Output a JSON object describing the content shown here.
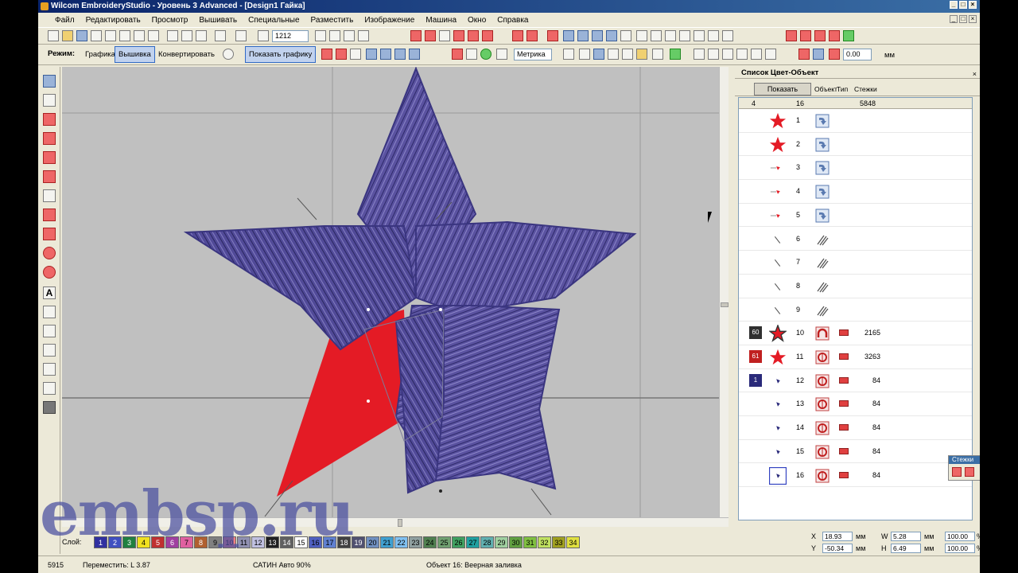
{
  "window": {
    "title": "Wilcom EmbroideryStudio - Уровень 3 Advanced - [Design1         Гайка]",
    "controls": [
      "_",
      "□",
      "×"
    ]
  },
  "menu": [
    "Файл",
    "Редактировать",
    "Просмотр",
    "Вышивать",
    "Специальные",
    "Разместить",
    "Изображение",
    "Машина",
    "Окно",
    "Справка"
  ],
  "toolbar1": {
    "zoom_value": "1212"
  },
  "toolbar2": {
    "mode_label": "Режим:",
    "graphics_label": "Графика",
    "embroidery_label": "Вышивка",
    "convert_label": "Конвертировать",
    "show_graphics_label": "Показать графику",
    "units_value": "Метрика",
    "angle_value": "0.00",
    "unit_suffix": "мм"
  },
  "panel": {
    "title": "Список Цвет-Объект",
    "show_button": "Показать",
    "col_objects": "Объект",
    "col_type": "Тип",
    "col_stitches": "Стежки",
    "header_counts": {
      "groups": "4",
      "objects": "16",
      "stitches": "5848"
    },
    "rows": [
      {
        "num": "1",
        "stitches": "",
        "group": "",
        "obj": "star-red",
        "type": "arrow"
      },
      {
        "num": "2",
        "stitches": "",
        "group": "",
        "obj": "star-red",
        "type": "arrow"
      },
      {
        "num": "3",
        "stitches": "",
        "group": "",
        "obj": "small-red",
        "type": "arrow"
      },
      {
        "num": "4",
        "stitches": "",
        "group": "",
        "obj": "small-red",
        "type": "arrow"
      },
      {
        "num": "5",
        "stitches": "",
        "group": "",
        "obj": "small-red",
        "type": "arrow"
      },
      {
        "num": "6",
        "stitches": "",
        "group": "",
        "obj": "line",
        "type": "hatch"
      },
      {
        "num": "7",
        "stitches": "",
        "group": "",
        "obj": "line",
        "type": "hatch"
      },
      {
        "num": "8",
        "stitches": "",
        "group": "",
        "obj": "line",
        "type": "hatch"
      },
      {
        "num": "9",
        "stitches": "",
        "group": "",
        "obj": "line",
        "type": "hatch"
      },
      {
        "num": "10",
        "stitches": "2165",
        "group": "60",
        "obj": "star-red-outline",
        "type": "satin"
      },
      {
        "num": "11",
        "stitches": "3263",
        "group": "61",
        "obj": "star-red",
        "type": "fill"
      },
      {
        "num": "12",
        "stitches": "84",
        "group": "1",
        "obj": "small-blue",
        "type": "fill"
      },
      {
        "num": "13",
        "stitches": "84",
        "group": "",
        "obj": "small-blue",
        "type": "fill"
      },
      {
        "num": "14",
        "stitches": "84",
        "group": "",
        "obj": "small-blue",
        "type": "fill"
      },
      {
        "num": "15",
        "stitches": "84",
        "group": "",
        "obj": "small-blue",
        "type": "fill"
      },
      {
        "num": "16",
        "stitches": "84",
        "group": "",
        "obj": "small-blue-selected",
        "type": "fill"
      }
    ]
  },
  "stitch_panel": {
    "title": "Стежки"
  },
  "palette": {
    "label": "Слой:",
    "swatches": [
      {
        "n": "1",
        "c": "#3030a0"
      },
      {
        "n": "2",
        "c": "#4050c0"
      },
      {
        "n": "3",
        "c": "#208040"
      },
      {
        "n": "4",
        "c": "#f0e020"
      },
      {
        "n": "5",
        "c": "#c03030"
      },
      {
        "n": "6",
        "c": "#a040a0"
      },
      {
        "n": "7",
        "c": "#e060a0"
      },
      {
        "n": "8",
        "c": "#b06030"
      },
      {
        "n": "9",
        "c": "#808080"
      },
      {
        "n": "10",
        "c": "#f08080"
      },
      {
        "n": "11",
        "c": "#9090b0"
      },
      {
        "n": "12",
        "c": "#c0c0e0"
      },
      {
        "n": "13",
        "c": "#202020"
      },
      {
        "n": "14",
        "c": "#606060"
      },
      {
        "n": "15",
        "c": "#ffffff"
      },
      {
        "n": "16",
        "c": "#5060c0"
      },
      {
        "n": "17",
        "c": "#6080d0"
      },
      {
        "n": "18",
        "c": "#404040"
      },
      {
        "n": "19",
        "c": "#505070"
      },
      {
        "n": "20",
        "c": "#7090c0"
      },
      {
        "n": "21",
        "c": "#40a0d0"
      },
      {
        "n": "22",
        "c": "#80c0f0"
      },
      {
        "n": "23",
        "c": "#90a0a0"
      },
      {
        "n": "24",
        "c": "#508050"
      },
      {
        "n": "25",
        "c": "#70a070"
      },
      {
        "n": "26",
        "c": "#40a060"
      },
      {
        "n": "27",
        "c": "#20a0a0"
      },
      {
        "n": "28",
        "c": "#60b0b0"
      },
      {
        "n": "29",
        "c": "#a0d0a0"
      },
      {
        "n": "30",
        "c": "#60a040"
      },
      {
        "n": "31",
        "c": "#80c040"
      },
      {
        "n": "32",
        "c": "#c0e060"
      },
      {
        "n": "33",
        "c": "#a0a020"
      },
      {
        "n": "34",
        "c": "#e0e040"
      }
    ]
  },
  "coords": {
    "x_label": "X",
    "x_value": "18.93",
    "y_label": "Y",
    "y_value": "-50.34",
    "w_label": "W",
    "w_value": "5.28",
    "h_label": "H",
    "h_value": "6.49",
    "sx_value": "100.00",
    "sy_value": "100.00",
    "unit": "мм",
    "pct": "%"
  },
  "status": {
    "stitch_count": "5915",
    "move_info": "Переместить: L  3.87",
    "stitch_type": "САТИН Авто 90%",
    "object_info": "Объект 16: Веерная заливка"
  },
  "watermark": "embsp.ru",
  "colors": {
    "thread_purple": "#5a52a0",
    "thread_red": "#e41b25",
    "canvas_bg": "#c0c0c0"
  }
}
